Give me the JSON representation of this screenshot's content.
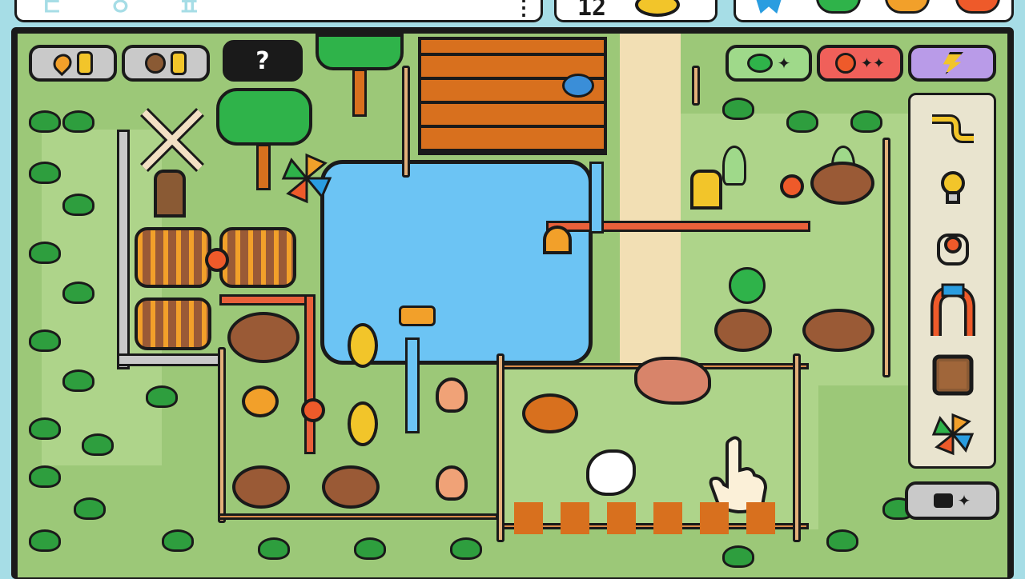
{
  "hud": {
    "left_label": "ㄷ ㅇ ㅍ",
    "menu_glyph": "⋮",
    "counter_value": "12",
    "badge_colors": [
      "#2a9de0",
      "#2fb34a",
      "#f2a02a",
      "#ee5a2a"
    ]
  },
  "resources": [
    {
      "icon": "heart-icon",
      "color": "#f2a02a"
    },
    {
      "icon": "seed-icon",
      "color": "#8a5a34"
    }
  ],
  "help_button_glyph": "?",
  "top_chips": [
    {
      "icon": "sprout-plus-icon",
      "color": "#9fd98a"
    },
    {
      "icon": "berries-plus-icon",
      "color": "#f0605a"
    },
    {
      "icon": "lightning-badge-icon",
      "color": "#b99be8"
    }
  ],
  "toolbar": [
    {
      "icon": "pipe-s-curve-icon"
    },
    {
      "icon": "light-bulb-icon"
    },
    {
      "icon": "valve-knob-icon"
    },
    {
      "icon": "pipe-arch-icon"
    },
    {
      "icon": "wooden-crate-icon"
    },
    {
      "icon": "pinwheel-icon"
    }
  ],
  "bottom_right_chip": {
    "icon": "power-plus-icon",
    "color": "#c9c9c9"
  },
  "colors": {
    "grass": "#9cc878",
    "water": "#6cc4f4",
    "brick": "#d8701e",
    "soil": "#9a5a36",
    "outline": "#1a1a1a",
    "path": "#f2dfb4"
  }
}
